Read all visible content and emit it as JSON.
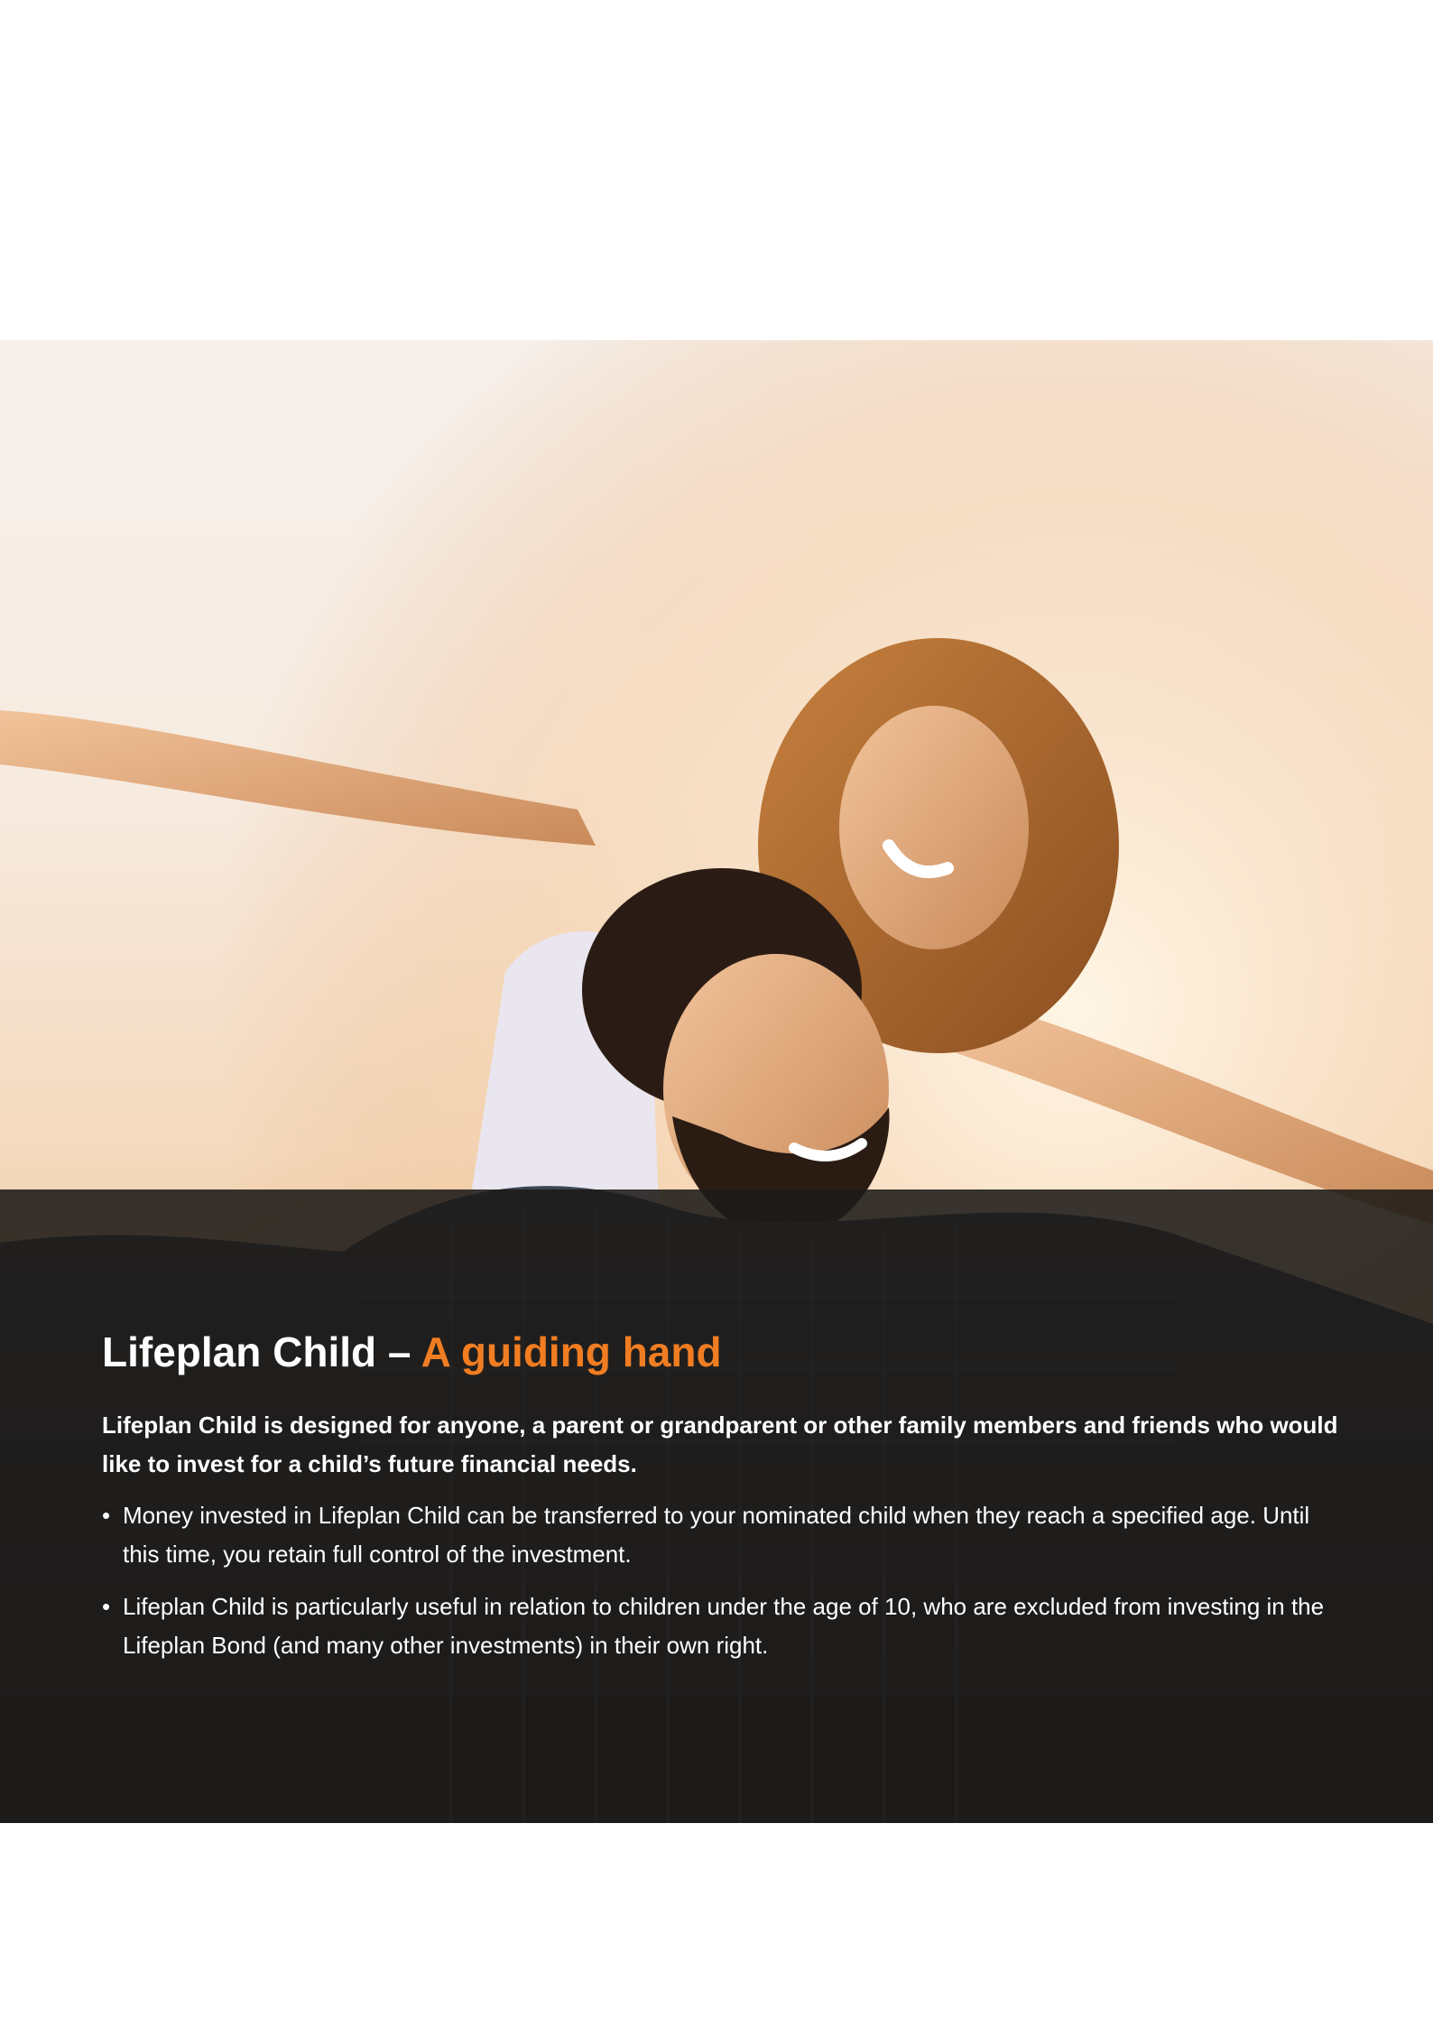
{
  "section": {
    "title": "Lifeplan Child",
    "title_separator": "–",
    "title_accent": "A guiding hand",
    "intro": "Lifeplan Child is designed for anyone, a parent or grandparent or other family members and friends who would like to invest for a child’s future financial needs.",
    "bullets": [
      "Money invested in Lifeplan Child can be transferred to your nominated child when they reach a specified age. Until this time, you retain full control of the investment.",
      "Lifeplan Child is particularly useful in relation to children under the age of 10, who are excluded from investing in the Lifeplan Bond (and many other investments) in their own right."
    ]
  },
  "colors": {
    "accent": "#f07d22",
    "overlay": "#1c1a18",
    "text": "#ffffff"
  },
  "image": {
    "icon": "photo-couple-piggyback-sunset"
  }
}
